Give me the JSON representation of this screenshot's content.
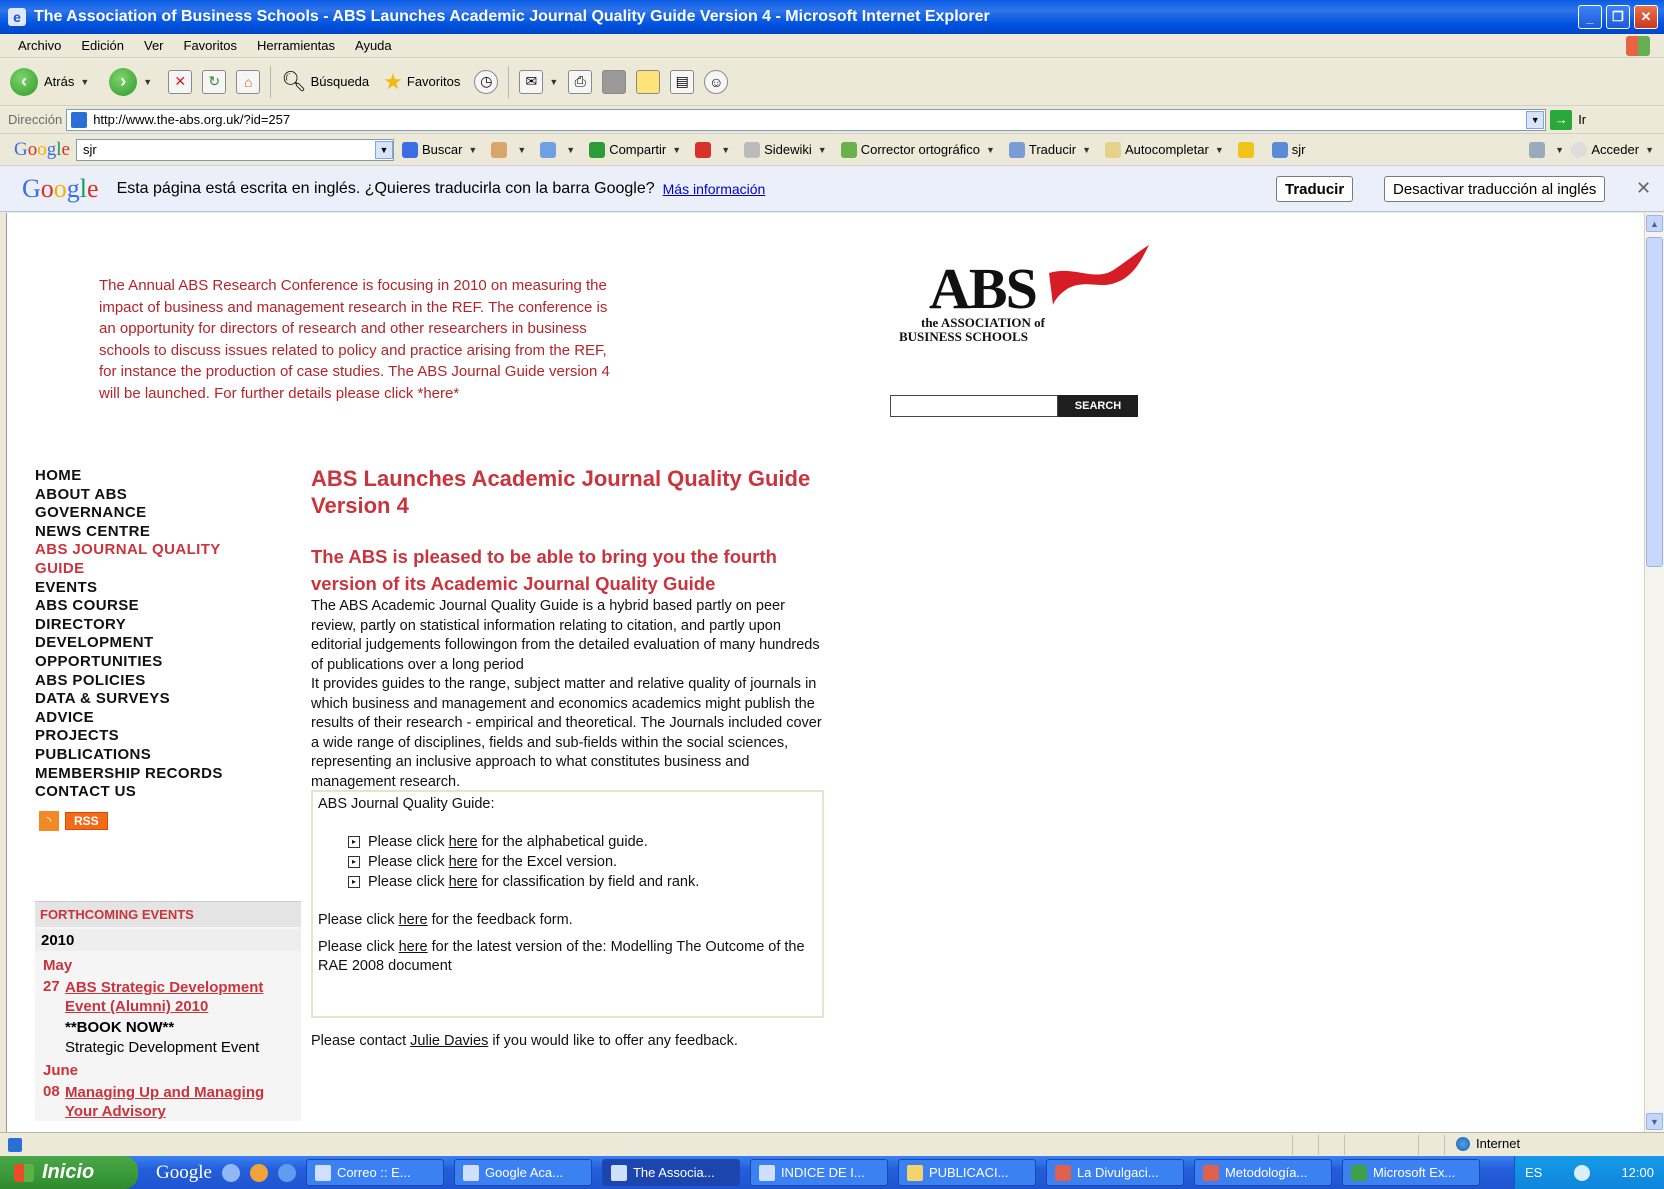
{
  "window": {
    "title": "The Association of Business Schools - ABS Launches Academic Journal Quality Guide Version 4 - Microsoft Internet Explorer"
  },
  "menu": [
    "Archivo",
    "Edición",
    "Ver",
    "Favoritos",
    "Herramientas",
    "Ayuda"
  ],
  "toolbar": {
    "back": "Atrás",
    "search": "Búsqueda",
    "favorites": "Favoritos"
  },
  "address": {
    "label": "Dirección",
    "url": "http://www.the-abs.org.uk/?id=257",
    "go": "Ir"
  },
  "google_toolbar": {
    "logo": "Google",
    "query": "sjr",
    "buscar": "Buscar",
    "compartir": "Compartir",
    "sidewiki": "Sidewiki",
    "corrector": "Corrector ortográfico",
    "traducir": "Traducir",
    "autocompletar": "Autocompletar",
    "highlight_term": "sjr",
    "acceder": "Acceder"
  },
  "translate_bar": {
    "logo": "Google",
    "message": "Esta página está escrita en inglés. ¿Quieres traducirla con la barra Google?",
    "more_info": "Más información",
    "translate_btn": "Traducir",
    "disable_btn": "Desactivar traducción al inglés"
  },
  "page": {
    "promo": "The Annual ABS Research Conference is focusing in 2010 on measuring the impact of business and management research in the REF. The conference is an opportunity for directors of research and other researchers in business schools to discuss issues related to policy and practice arising from the REF, for instance the production of case studies. The ABS Journal Guide version 4 will be launched. For further details please click *here*",
    "logo": {
      "letters": "ABS",
      "line1": "the ASSOCIATION of",
      "line2": "BUSINESS SCHOOLS"
    },
    "search_button": "SEARCH",
    "nav": [
      "HOME",
      "ABOUT ABS",
      "GOVERNANCE",
      "NEWS CENTRE",
      "ABS JOURNAL QUALITY GUIDE",
      "EVENTS",
      "ABS COURSE DIRECTORY",
      "DEVELOPMENT OPPORTUNITIES",
      "ABS POLICIES",
      "DATA & SURVEYS",
      "ADVICE",
      "PROJECTS",
      "PUBLICATIONS",
      "MEMBERSHIP RECORDS",
      "CONTACT US"
    ],
    "rss": "RSS",
    "events": {
      "header": "FORTHCOMING EVENTS",
      "year": "2010",
      "month1": "May",
      "event1": {
        "day": "27",
        "title": "ABS Strategic Development Event (Alumni) 2010",
        "note1": "**BOOK NOW**",
        "note2": "Strategic Development Event"
      },
      "month2": "June",
      "event2": {
        "day": "08",
        "title": "Managing Up and Managing Your Advisory"
      }
    },
    "heading": "ABS Launches Academic Journal Quality Guide Version 4",
    "subheading": "The ABS is pleased to be able to bring you the fourth version of its Academic Journal Quality Guide",
    "para1": "The ABS Academic Journal Quality Guide is a hybrid based partly on peer review, partly on statistical information relating to citation, and partly upon editorial judgements followingon from the detailed evaluation of many hundreds of publications over a long period",
    "para2": "It provides guides to the range, subject matter and relative quality of journals in which business and management and economics academics might publish the results of their research - empirical and theoretical. The Journals included cover a wide range of disciplines, fields and sub-fields within the social sciences, representing an inclusive approach to what constitutes business and management research.",
    "guide": {
      "title": "ABS Journal Quality Guide:",
      "link_word": "here",
      "items": [
        {
          "pre": "Please click",
          "post": "for the alphabetical guide."
        },
        {
          "pre": "Please click",
          "post": "for the Excel version."
        },
        {
          "pre": "Please click",
          "post": "for classification by field and rank."
        }
      ],
      "feedback_pre": "Please click",
      "feedback_post": "for the feedback form.",
      "latest_pre": "Please click",
      "latest_post": "for the latest version of the: Modelling The Outcome of the RAE 2008 document"
    },
    "contact": {
      "pre": "Please contact",
      "name": "Julie Davies",
      "post": "if you would like to offer any feedback."
    }
  },
  "status": {
    "zone": "Internet"
  },
  "taskbar": {
    "start": "Inicio",
    "google": "Google",
    "tasks": [
      "Correo :: E...",
      "Google Aca...",
      "The Associa...",
      "INDICE DE I...",
      "PUBLICACI...",
      "La Divulgaci...",
      "Metodología...",
      "Microsoft Ex..."
    ],
    "lang": "ES",
    "clock": "12:00"
  }
}
